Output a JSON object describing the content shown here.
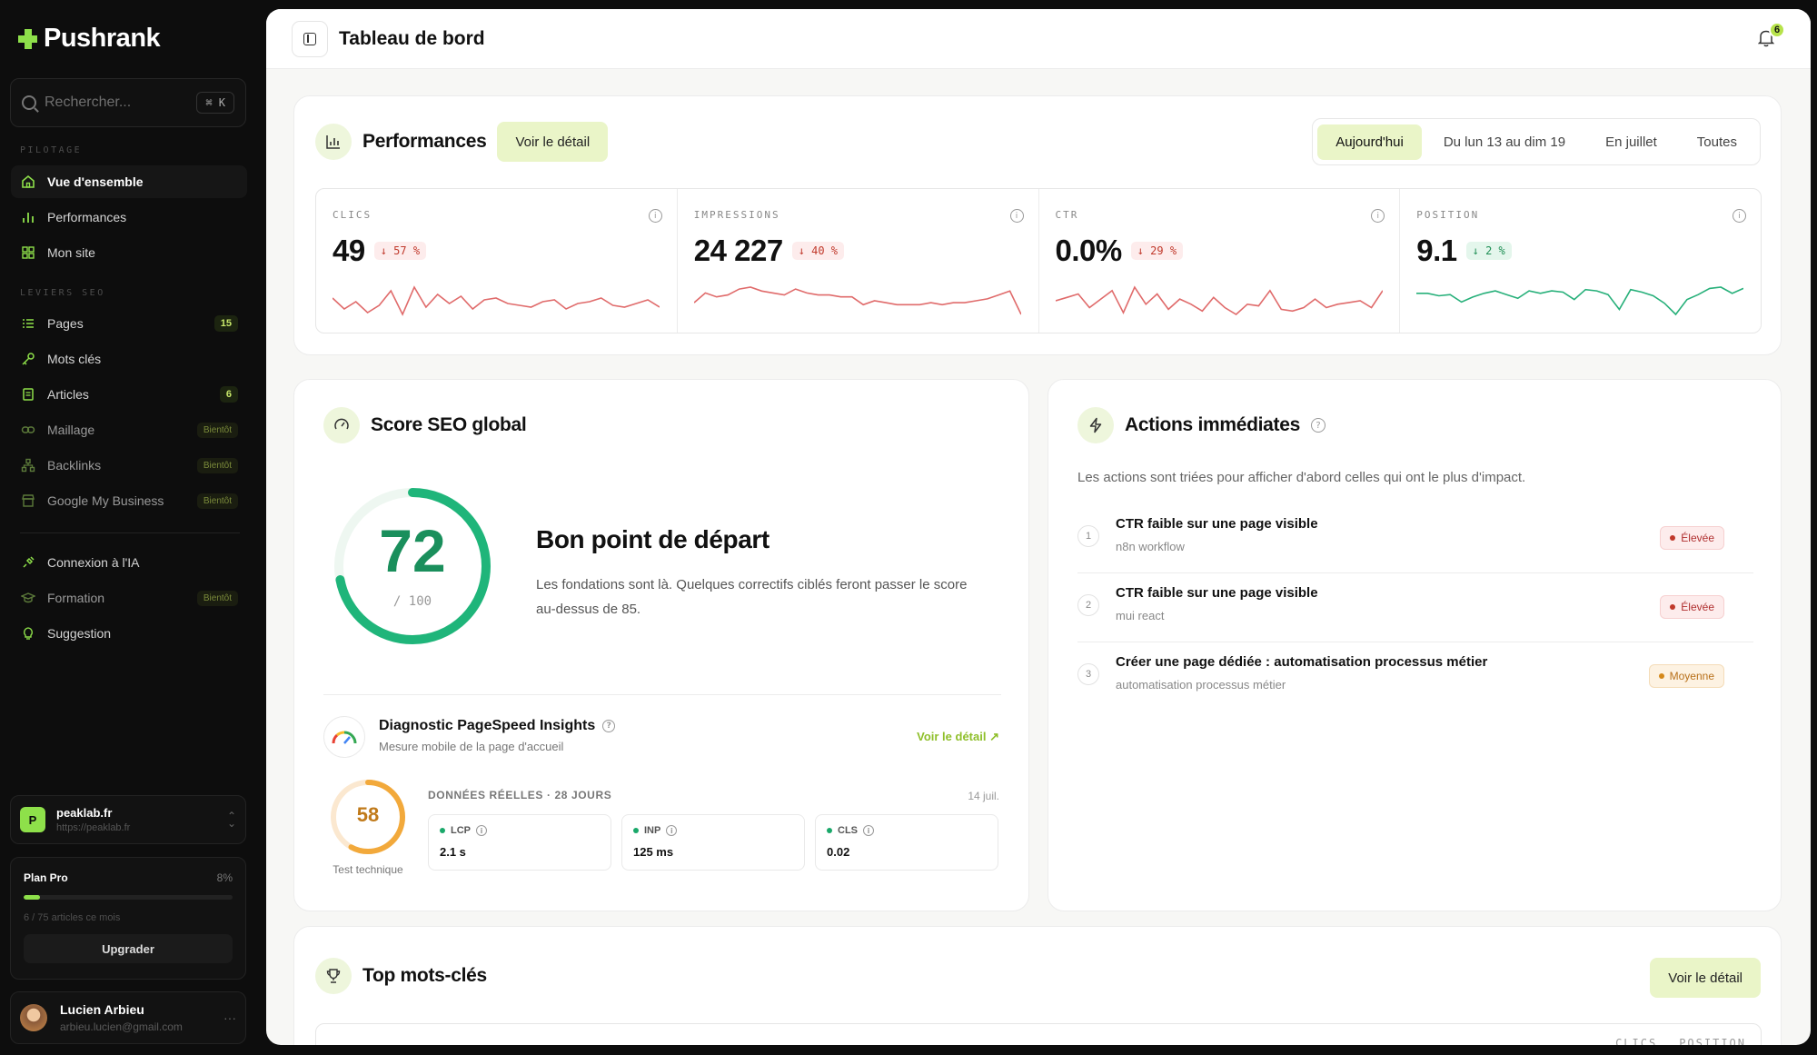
{
  "brand": {
    "name": "Pushrank",
    "accent": "#8ee04a"
  },
  "search": {
    "placeholder": "Rechercher...",
    "shortcut": "⌘ K"
  },
  "sidebar": {
    "section_pilotage": "PILOTAGE",
    "section_leviers": "LEVIERS SEO",
    "items": [
      {
        "label": "Vue d'ensemble",
        "icon": "home-icon",
        "active": true
      },
      {
        "label": "Performances",
        "icon": "bar-chart-icon"
      },
      {
        "label": "Mon site",
        "icon": "grid-icon"
      },
      {
        "label": "Pages",
        "icon": "list-icon",
        "badge": "15"
      },
      {
        "label": "Mots clés",
        "icon": "key-icon"
      },
      {
        "label": "Articles",
        "icon": "document-icon",
        "badge": "6"
      },
      {
        "label": "Maillage",
        "icon": "link-icon",
        "soon": "Bientôt"
      },
      {
        "label": "Backlinks",
        "icon": "network-icon",
        "soon": "Bientôt"
      },
      {
        "label": "Google My Business",
        "icon": "store-icon",
        "soon": "Bientôt"
      },
      {
        "label": "Connexion à l'IA",
        "icon": "plug-icon"
      },
      {
        "label": "Formation",
        "icon": "graduation-icon",
        "soon": "Bientôt"
      },
      {
        "label": "Suggestion",
        "icon": "lightbulb-icon"
      }
    ]
  },
  "site": {
    "initial": "P",
    "name": "peaklab.fr",
    "url": "https://peaklab.fr"
  },
  "plan": {
    "name": "Plan Pro",
    "percent_label": "8%",
    "progress": 0.08,
    "usage": "6 / 75 articles ce mois",
    "upgrade_label": "Upgrader"
  },
  "user": {
    "name": "Lucien Arbieu",
    "email": "arbieu.lucien@gmail.com",
    "more": "···"
  },
  "header": {
    "title": "Tableau de bord",
    "notifications": "6"
  },
  "performances": {
    "title": "Performances",
    "detail_label": "Voir le détail",
    "periods": [
      "Aujourd'hui",
      "Du lun 13 au dim 19",
      "En juillet",
      "Toutes"
    ],
    "selected_period": "Aujourd'hui",
    "kpis": [
      {
        "label": "CLICS",
        "value": "49",
        "delta": "↓ 57 %",
        "trend": "down",
        "color": "#e06b6b",
        "spark": [
          18,
          12,
          16,
          10,
          14,
          22,
          9,
          24,
          13,
          20,
          15,
          19,
          12,
          17,
          18,
          15,
          14,
          13,
          16,
          17,
          12,
          15,
          16,
          18,
          14,
          13,
          15,
          17,
          13
        ]
      },
      {
        "label": "IMPRESSIONS",
        "value": "24 227",
        "delta": "↓ 40 %",
        "trend": "down",
        "color": "#e06b6b",
        "spark": [
          14,
          19,
          17,
          18,
          21,
          22,
          20,
          19,
          18,
          21,
          19,
          18,
          18,
          17,
          17,
          13,
          15,
          14,
          13,
          13,
          13,
          14,
          13,
          14,
          14,
          15,
          16,
          18,
          20,
          8
        ]
      },
      {
        "label": "CTR",
        "value": "0.0%",
        "delta": "↓ 29 %",
        "trend": "down",
        "color": "#e06b6b",
        "spark": [
          16,
          18,
          20,
          12,
          17,
          22,
          9,
          24,
          14,
          20,
          11,
          17,
          14,
          10,
          18,
          12,
          8,
          14,
          13,
          22,
          11,
          10,
          12,
          17,
          12,
          14,
          15,
          16,
          12,
          22
        ]
      },
      {
        "label": "POSITION",
        "value": "9.1",
        "delta": "↓ 2 %",
        "trend": "up",
        "color": "#27b07a",
        "spark": [
          20,
          20,
          18,
          19,
          13,
          17,
          20,
          22,
          19,
          16,
          22,
          20,
          22,
          21,
          15,
          23,
          22,
          19,
          7,
          23,
          21,
          18,
          12,
          3,
          15,
          19,
          24,
          25,
          20,
          24
        ]
      }
    ]
  },
  "seo_score": {
    "title": "Score SEO global",
    "score": "72",
    "score_value": 72,
    "max_label": "/ 100",
    "headline": "Bon point de départ",
    "text": "Les fondations sont là. Quelques correctifs ciblés feront passer le score au-dessus de 85.",
    "pagespeed": {
      "title": "Diagnostic PageSpeed Insights",
      "subtitle": "Mesure mobile de la page d'accueil",
      "link": "Voir le détail",
      "score": "58",
      "score_value": 58,
      "score_label": "Test technique",
      "real_data_label": "DONNÉES RÉELLES · 28 JOURS",
      "date": "14 juil.",
      "metrics": [
        {
          "name": "LCP",
          "value": "2.1 s"
        },
        {
          "name": "INP",
          "value": "125 ms"
        },
        {
          "name": "CLS",
          "value": "0.02"
        }
      ]
    }
  },
  "actions": {
    "title": "Actions immédiates",
    "description": "Les actions sont triées pour afficher d'abord celles qui ont le plus d'impact.",
    "items": [
      {
        "num": "1",
        "title": "CTR faible sur une page visible",
        "subtitle": "n8n workflow",
        "priority": "Élevée",
        "level": "high"
      },
      {
        "num": "2",
        "title": "CTR faible sur une page visible",
        "subtitle": "mui react",
        "priority": "Élevée",
        "level": "high"
      },
      {
        "num": "3",
        "title": "Créer une page dédiée : automatisation processus métier",
        "subtitle": "automatisation processus métier",
        "priority": "Moyenne",
        "level": "mid"
      }
    ]
  },
  "top_keywords": {
    "title": "Top mots-clés",
    "detail_label": "Voir le détail",
    "col_clicks": "CLICS",
    "col_position": "POSITION"
  }
}
